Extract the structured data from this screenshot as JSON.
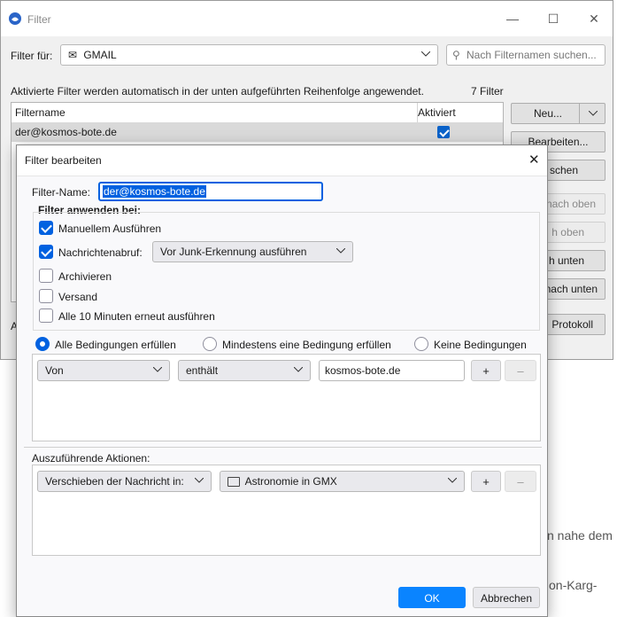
{
  "background": {
    "line1": "n nahe dem",
    "line2": "on-Karg-"
  },
  "filter_window": {
    "title": "Filter",
    "filter_for_label": "Filter für:",
    "account": "GMAIL",
    "search_placeholder": "Nach Filternamen suchen...",
    "info_text": "Aktivierte Filter werden automatisch in der unten aufgeführten Reihenfolge angewendet.",
    "count": "7 Filter",
    "columns": {
      "name": "Filtername",
      "active": "Aktiviert"
    },
    "first_row": "der@kosmos-bote.de",
    "buttons": {
      "new": "Neu...",
      "edit": "Bearbeiten...",
      "delete_partial": "schen",
      "to_top_partial": "nach oben",
      "up_partial": "h oben",
      "down_partial": "h unten",
      "to_bottom_partial": "nach unten",
      "log_partial": "Protokoll"
    },
    "bottom_partial": "A"
  },
  "edit_dialog": {
    "title": "Filter bearbeiten",
    "name_label": "Filter-Name:",
    "name_value": "der@kosmos-bote.de",
    "apply_heading": "Filter anwenden bei:",
    "manual": "Manuellem Ausführen",
    "fetch": "Nachrichtenabruf:",
    "fetch_option": "Vor Junk-Erkennung ausführen",
    "archive": "Archivieren",
    "send": "Versand",
    "periodic": "Alle 10 Minuten erneut ausführen",
    "match_all": "Alle Bedingungen erfüllen",
    "match_any": "Mindestens eine Bedingung erfüllen",
    "match_none": "Keine Bedingungen",
    "condition": {
      "field": "Von",
      "operator": "enthält",
      "value": "kosmos-bote.de"
    },
    "actions_heading": "Auszuführende Aktionen:",
    "action": {
      "type": "Verschieben der Nachricht in:",
      "folder": "Astronomie in GMX"
    },
    "ok": "OK",
    "cancel": "Abbrechen"
  },
  "colors": {
    "accent": "#0061e0",
    "ok_button": "#0a84ff"
  }
}
